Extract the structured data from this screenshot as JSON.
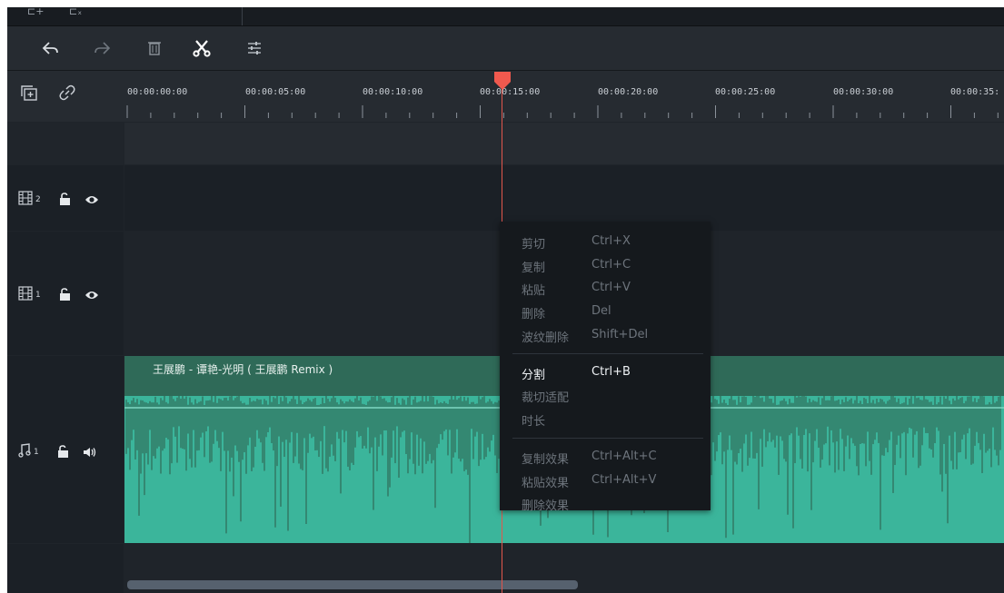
{
  "toolbar": {
    "undo_icon": "undo-icon",
    "redo_icon": "redo-icon",
    "delete_icon": "trash-icon",
    "cut_icon": "scissors-icon",
    "adjust_icon": "sliders-icon"
  },
  "ruler": {
    "timecodes": [
      "00:00:00:00",
      "00:00:05:00",
      "00:00:10:00",
      "00:00:15:00",
      "00:00:20:00",
      "00:00:25:00",
      "00:00:30:00",
      "00:00:35:"
    ]
  },
  "tracks": {
    "video2_number": "2",
    "video1_number": "1",
    "audio1_number": "1"
  },
  "clip": {
    "title": "王展鹏 - 谭艳-光明 ( 王展鹏 Remix )"
  },
  "context_menu": {
    "items": [
      {
        "label": "剪切",
        "shortcut": "Ctrl+X"
      },
      {
        "label": "复制",
        "shortcut": "Ctrl+C"
      },
      {
        "label": "粘贴",
        "shortcut": "Ctrl+V"
      },
      {
        "label": "删除",
        "shortcut": "Del"
      },
      {
        "label": "波纹删除",
        "shortcut": "Shift+Del"
      },
      {
        "label": "分割",
        "shortcut": "Ctrl+B"
      },
      {
        "label": "裁切适配",
        "shortcut": ""
      },
      {
        "label": "时长",
        "shortcut": ""
      },
      {
        "label": "复制效果",
        "shortcut": "Ctrl+Alt+C"
      },
      {
        "label": "粘贴效果",
        "shortcut": "Ctrl+Alt+V"
      },
      {
        "label": "删除效果",
        "shortcut": ""
      }
    ]
  },
  "colors": {
    "playhead": "#e2564c",
    "clip_wave": "#3bb59b",
    "clip_header": "#2f6a58"
  }
}
